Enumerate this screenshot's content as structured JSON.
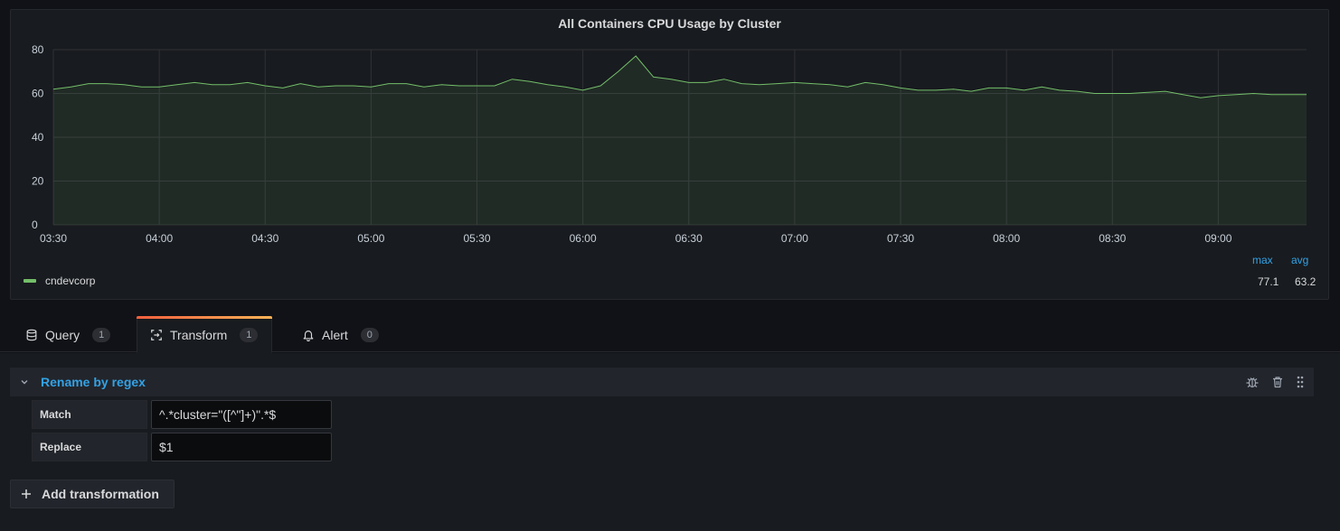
{
  "panel": {
    "title": "All Containers CPU Usage by Cluster",
    "legend": {
      "headers": [
        "max",
        "avg"
      ],
      "series_name": "cndevcorp",
      "max": "77.1",
      "avg": "63.2"
    }
  },
  "chart_data": {
    "type": "area",
    "title": "All Containers CPU Usage by Cluster",
    "ylim": [
      0,
      80
    ],
    "yticks": [
      0,
      20,
      40,
      60,
      80
    ],
    "xticks": [
      "03:30",
      "04:00",
      "04:30",
      "05:00",
      "05:30",
      "06:00",
      "06:30",
      "07:00",
      "07:30",
      "08:00",
      "08:30",
      "09:00"
    ],
    "xlim": [
      "03:30",
      "09:25"
    ],
    "grid": true,
    "legend_position": "bottom",
    "series": [
      {
        "name": "cndevcorp",
        "color": "#73bf69",
        "x": [
          "03:30",
          "03:35",
          "03:40",
          "03:45",
          "03:50",
          "03:55",
          "04:00",
          "04:05",
          "04:10",
          "04:15",
          "04:20",
          "04:25",
          "04:30",
          "04:35",
          "04:40",
          "04:45",
          "04:50",
          "04:55",
          "05:00",
          "05:05",
          "05:10",
          "05:15",
          "05:20",
          "05:25",
          "05:30",
          "05:35",
          "05:40",
          "05:45",
          "05:50",
          "05:55",
          "06:00",
          "06:05",
          "06:10",
          "06:15",
          "06:20",
          "06:25",
          "06:30",
          "06:35",
          "06:40",
          "06:45",
          "06:50",
          "06:55",
          "07:00",
          "07:05",
          "07:10",
          "07:15",
          "07:20",
          "07:25",
          "07:30",
          "07:35",
          "07:40",
          "07:45",
          "07:50",
          "07:55",
          "08:00",
          "08:05",
          "08:10",
          "08:15",
          "08:20",
          "08:25",
          "08:30",
          "08:35",
          "08:40",
          "08:45",
          "08:50",
          "08:55",
          "09:00",
          "09:05",
          "09:10",
          "09:15",
          "09:20",
          "09:25"
        ],
        "values": [
          62,
          63,
          64.5,
          64.5,
          64,
          63,
          63,
          64,
          65,
          64,
          64,
          65,
          63.5,
          62.5,
          64.5,
          63,
          63.5,
          63.5,
          63,
          64.5,
          64.5,
          63,
          64,
          63.5,
          63.5,
          63.5,
          66.5,
          65.5,
          64,
          63,
          61.5,
          63.5,
          70,
          77.1,
          67.5,
          66.5,
          65,
          65,
          66.5,
          64.5,
          64,
          64.5,
          65,
          64.5,
          64,
          63,
          65,
          64,
          62.5,
          61.5,
          61.5,
          62,
          61,
          62.5,
          62.5,
          61.5,
          63,
          61.5,
          61,
          60,
          60,
          60,
          60.5,
          61,
          59.5,
          58,
          59,
          59.5,
          60,
          59.5,
          59.5,
          59.5
        ]
      }
    ]
  },
  "tabs": [
    {
      "label": "Query",
      "count": "1"
    },
    {
      "label": "Transform",
      "count": "1"
    },
    {
      "label": "Alert",
      "count": "0"
    }
  ],
  "transform": {
    "title": "Rename by regex",
    "match_label": "Match",
    "match_value": "^.*cluster=\"([^\"]+)\".*$",
    "replace_label": "Replace",
    "replace_value": "$1",
    "add_label": "Add transformation"
  },
  "colors": {
    "accent": "#33a2e5",
    "series": "#73bf69",
    "tab_gradient_start": "#f55f3e",
    "tab_gradient_end": "#ffb357"
  },
  "icons": {
    "query": "database-icon",
    "transform": "transform-icon",
    "alert": "bell-icon",
    "debug": "bug-icon",
    "delete": "trash-icon",
    "drag": "drag-handle-icon",
    "collapse": "chevron-down-icon",
    "add": "plus-icon"
  }
}
